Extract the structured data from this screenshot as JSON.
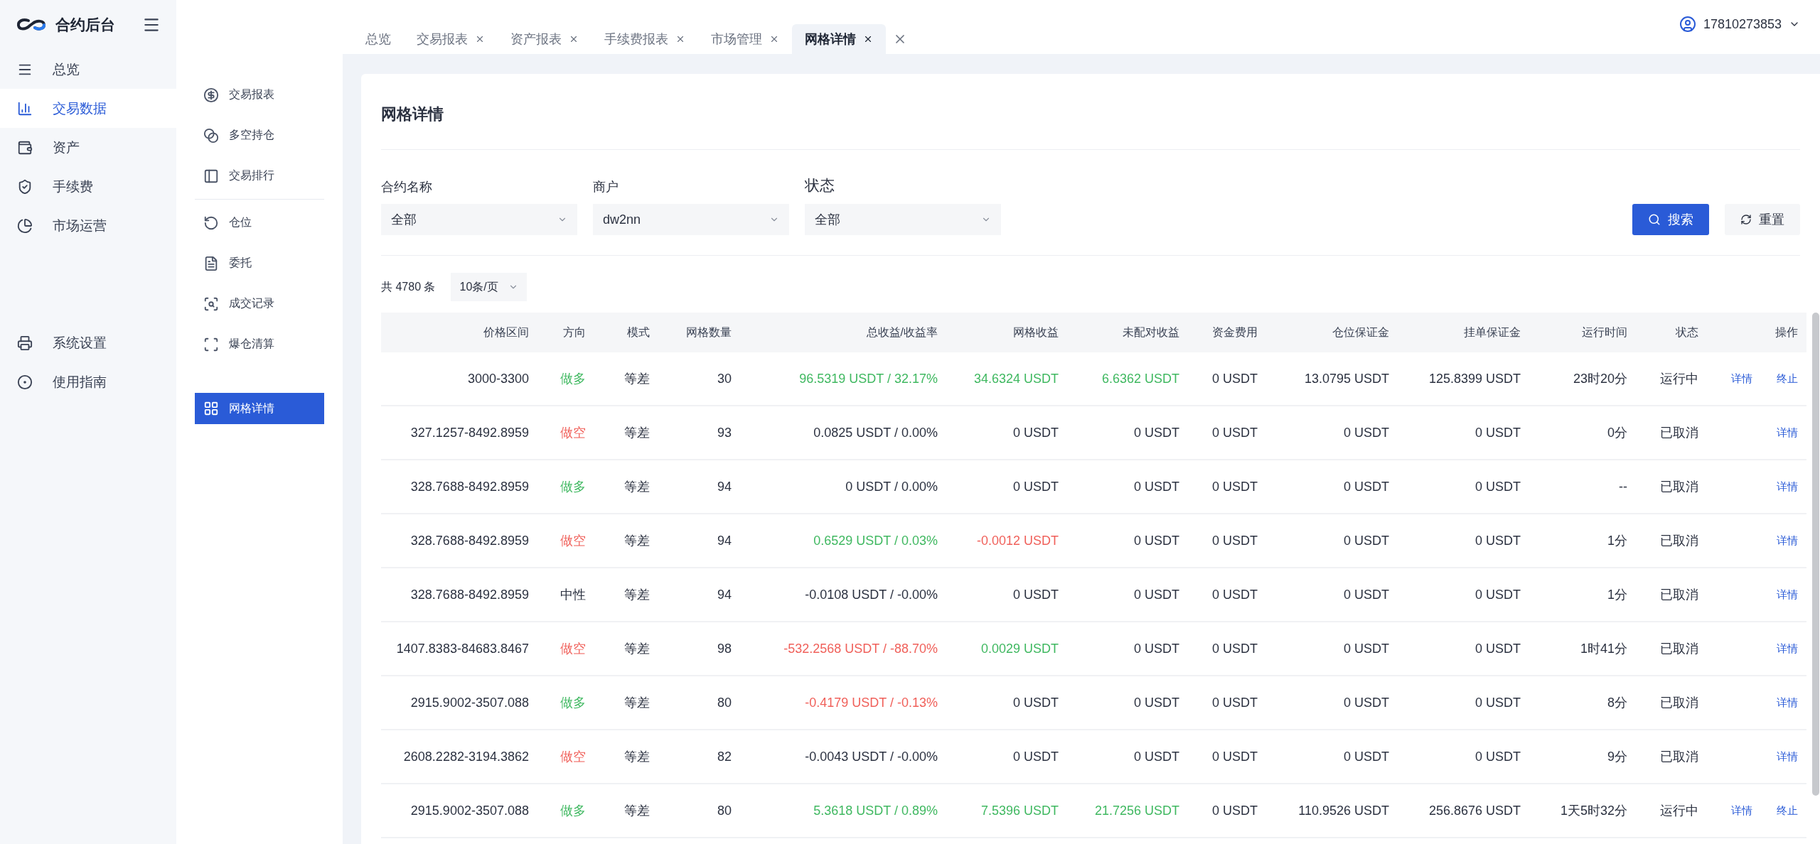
{
  "brand": {
    "title": "合约后台"
  },
  "sidebar": {
    "items": [
      {
        "label": "总览",
        "selected": false
      },
      {
        "label": "交易数据",
        "selected": true
      },
      {
        "label": "资产",
        "selected": false
      },
      {
        "label": "手续费",
        "selected": false
      },
      {
        "label": "市场运营",
        "selected": false
      },
      {
        "label": "系统设置",
        "selected": false
      },
      {
        "label": "使用指南",
        "selected": false
      }
    ]
  },
  "submenu": {
    "items": [
      {
        "label": "交易报表",
        "selected": false
      },
      {
        "label": "多空持仓",
        "selected": false
      },
      {
        "label": "交易排行",
        "selected": false
      },
      {
        "label": "仓位",
        "selected": false
      },
      {
        "label": "委托",
        "selected": false
      },
      {
        "label": "成交记录",
        "selected": false
      },
      {
        "label": "爆仓清算",
        "selected": false
      },
      {
        "label": "网格详情",
        "selected": true
      }
    ]
  },
  "tabs": [
    {
      "label": "总览",
      "closable": false,
      "selected": false
    },
    {
      "label": "交易报表",
      "closable": true,
      "selected": false
    },
    {
      "label": "资产报表",
      "closable": true,
      "selected": false
    },
    {
      "label": "手续费报表",
      "closable": true,
      "selected": false
    },
    {
      "label": "市场管理",
      "closable": true,
      "selected": false
    },
    {
      "label": "网格详情",
      "closable": true,
      "selected": true
    }
  ],
  "user": {
    "name": "17810273853"
  },
  "page": {
    "title": "网格详情"
  },
  "filters": [
    {
      "label": "合约名称",
      "value": "全部"
    },
    {
      "label": "商户",
      "value": "dw2nn"
    },
    {
      "label": "状态",
      "value": "全部"
    }
  ],
  "buttons": {
    "search": "搜索",
    "reset": "重置"
  },
  "pagination": {
    "total": "共 4780 条",
    "page_size": "10条/页"
  },
  "table": {
    "columns": [
      "价格区间",
      "方向",
      "模式",
      "网格数量",
      "总收益/收益率",
      "网格收益",
      "未配对收益",
      "资金费用",
      "仓位保证金",
      "挂单保证金",
      "运行时间",
      "状态",
      "操作"
    ],
    "rows": [
      {
        "price_range": "3000-3300",
        "direction": {
          "text": "做多",
          "color": "#3fb860"
        },
        "mode": "等差",
        "grid_count": "30",
        "total_return": {
          "text": "96.5319 USDT / 32.17%",
          "color": "#3fb860"
        },
        "grid_profit": {
          "text": "34.6324 USDT",
          "color": "#3fb860"
        },
        "unpaired_profit": {
          "text": "6.6362 USDT",
          "color": "#3fb860"
        },
        "funding_fee": "0 USDT",
        "position_margin": "13.0795 USDT",
        "order_margin": "125.8399 USDT",
        "run_time": "23时20分",
        "status": "运行中",
        "actions": [
          "详情",
          "终止"
        ]
      },
      {
        "price_range": "327.1257-8492.8959",
        "direction": {
          "text": "做空",
          "color": "#f0605a"
        },
        "mode": "等差",
        "grid_count": "93",
        "total_return": {
          "text": "0.0825 USDT / 0.00%",
          "color": "#2b3140"
        },
        "grid_profit": {
          "text": "0 USDT",
          "color": "#2b3140"
        },
        "unpaired_profit": {
          "text": "0 USDT",
          "color": "#2b3140"
        },
        "funding_fee": "0 USDT",
        "position_margin": "0 USDT",
        "order_margin": "0 USDT",
        "run_time": "0分",
        "status": "已取消",
        "actions": [
          "详情"
        ]
      },
      {
        "price_range": "328.7688-8492.8959",
        "direction": {
          "text": "做多",
          "color": "#3fb860"
        },
        "mode": "等差",
        "grid_count": "94",
        "total_return": {
          "text": "0 USDT / 0.00%",
          "color": "#2b3140"
        },
        "grid_profit": {
          "text": "0 USDT",
          "color": "#2b3140"
        },
        "unpaired_profit": {
          "text": "0 USDT",
          "color": "#2b3140"
        },
        "funding_fee": "0 USDT",
        "position_margin": "0 USDT",
        "order_margin": "0 USDT",
        "run_time": "--",
        "status": "已取消",
        "actions": [
          "详情"
        ]
      },
      {
        "price_range": "328.7688-8492.8959",
        "direction": {
          "text": "做空",
          "color": "#f0605a"
        },
        "mode": "等差",
        "grid_count": "94",
        "total_return": {
          "text": "0.6529 USDT / 0.03%",
          "color": "#3fb860"
        },
        "grid_profit": {
          "text": "-0.0012 USDT",
          "color": "#f0605a"
        },
        "unpaired_profit": {
          "text": "0 USDT",
          "color": "#2b3140"
        },
        "funding_fee": "0 USDT",
        "position_margin": "0 USDT",
        "order_margin": "0 USDT",
        "run_time": "1分",
        "status": "已取消",
        "actions": [
          "详情"
        ]
      },
      {
        "price_range": "328.7688-8492.8959",
        "direction": {
          "text": "中性",
          "color": "#2b3140"
        },
        "mode": "等差",
        "grid_count": "94",
        "total_return": {
          "text": "-0.0108 USDT / -0.00%",
          "color": "#2b3140"
        },
        "grid_profit": {
          "text": "0 USDT",
          "color": "#2b3140"
        },
        "unpaired_profit": {
          "text": "0 USDT",
          "color": "#2b3140"
        },
        "funding_fee": "0 USDT",
        "position_margin": "0 USDT",
        "order_margin": "0 USDT",
        "run_time": "1分",
        "status": "已取消",
        "actions": [
          "详情"
        ]
      },
      {
        "price_range": "1407.8383-84683.8467",
        "direction": {
          "text": "做空",
          "color": "#f0605a"
        },
        "mode": "等差",
        "grid_count": "98",
        "total_return": {
          "text": "-532.2568 USDT / -88.70%",
          "color": "#f0605a"
        },
        "grid_profit": {
          "text": "0.0029 USDT",
          "color": "#3fb860"
        },
        "unpaired_profit": {
          "text": "0 USDT",
          "color": "#2b3140"
        },
        "funding_fee": "0 USDT",
        "position_margin": "0 USDT",
        "order_margin": "0 USDT",
        "run_time": "1时41分",
        "status": "已取消",
        "actions": [
          "详情"
        ]
      },
      {
        "price_range": "2915.9002-3507.088",
        "direction": {
          "text": "做多",
          "color": "#3fb860"
        },
        "mode": "等差",
        "grid_count": "80",
        "total_return": {
          "text": "-0.4179 USDT / -0.13%",
          "color": "#f0605a"
        },
        "grid_profit": {
          "text": "0 USDT",
          "color": "#2b3140"
        },
        "unpaired_profit": {
          "text": "0 USDT",
          "color": "#2b3140"
        },
        "funding_fee": "0 USDT",
        "position_margin": "0 USDT",
        "order_margin": "0 USDT",
        "run_time": "8分",
        "status": "已取消",
        "actions": [
          "详情"
        ]
      },
      {
        "price_range": "2608.2282-3194.3862",
        "direction": {
          "text": "做空",
          "color": "#f0605a"
        },
        "mode": "等差",
        "grid_count": "82",
        "total_return": {
          "text": "-0.0043 USDT / -0.00%",
          "color": "#2b3140"
        },
        "grid_profit": {
          "text": "0 USDT",
          "color": "#2b3140"
        },
        "unpaired_profit": {
          "text": "0 USDT",
          "color": "#2b3140"
        },
        "funding_fee": "0 USDT",
        "position_margin": "0 USDT",
        "order_margin": "0 USDT",
        "run_time": "9分",
        "status": "已取消",
        "actions": [
          "详情"
        ]
      },
      {
        "price_range": "2915.9002-3507.088",
        "direction": {
          "text": "做多",
          "color": "#3fb860"
        },
        "mode": "等差",
        "grid_count": "80",
        "total_return": {
          "text": "5.3618 USDT / 0.89%",
          "color": "#3fb860"
        },
        "grid_profit": {
          "text": "7.5396 USDT",
          "color": "#3fb860"
        },
        "unpaired_profit": {
          "text": "21.7256 USDT",
          "color": "#3fb860"
        },
        "funding_fee": "0 USDT",
        "position_margin": "110.9526 USDT",
        "order_margin": "256.8676 USDT",
        "run_time": "1天5时32分",
        "status": "运行中",
        "actions": [
          "详情",
          "终止"
        ]
      }
    ]
  }
}
